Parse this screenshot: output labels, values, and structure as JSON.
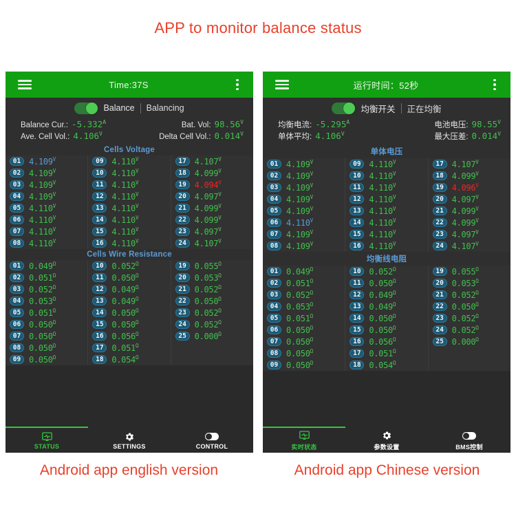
{
  "page": {
    "title": "APP to monitor balance status",
    "caption_left": "Android app english version",
    "caption_right": "Android app Chinese version",
    "accent_red": "#e8402a",
    "accent_green": "#12a013",
    "value_green": "#3fc14c",
    "badge_blue": "#1d5a75",
    "alert_red": "#f4231f",
    "section_blue": "#5b9bd5"
  },
  "en": {
    "appbar": {
      "menu_icon": "hamburger-icon",
      "title": "Time:37S",
      "overflow_icon": "kebab-menu-icon"
    },
    "toggle": {
      "label": "Balance",
      "state": "Balancing",
      "on": true
    },
    "info": [
      {
        "key": "Balance Cur.:",
        "value": "-5.332",
        "unit": "A"
      },
      {
        "key": "Bat. Vol:",
        "value": "98.56",
        "unit": "V"
      },
      {
        "key": "Ave. Cell Vol.:",
        "value": "4.106",
        "unit": "V"
      },
      {
        "key": "Delta Cell Vol.:",
        "value": "0.014",
        "unit": "V"
      }
    ],
    "voltage_section_title": "Cells Voltage",
    "voltage_unit": "V",
    "voltage_cells": [
      [
        {
          "id": "01",
          "v": "4.109",
          "s": "hi"
        },
        {
          "id": "02",
          "v": "4.109",
          "s": ""
        },
        {
          "id": "03",
          "v": "4.109",
          "s": ""
        },
        {
          "id": "04",
          "v": "4.109",
          "s": ""
        },
        {
          "id": "05",
          "v": "4.110",
          "s": ""
        },
        {
          "id": "06",
          "v": "4.110",
          "s": ""
        },
        {
          "id": "07",
          "v": "4.110",
          "s": ""
        },
        {
          "id": "08",
          "v": "4.110",
          "s": ""
        }
      ],
      [
        {
          "id": "09",
          "v": "4.110",
          "s": ""
        },
        {
          "id": "10",
          "v": "4.110",
          "s": ""
        },
        {
          "id": "11",
          "v": "4.110",
          "s": ""
        },
        {
          "id": "12",
          "v": "4.110",
          "s": ""
        },
        {
          "id": "13",
          "v": "4.110",
          "s": ""
        },
        {
          "id": "14",
          "v": "4.110",
          "s": ""
        },
        {
          "id": "15",
          "v": "4.110",
          "s": ""
        },
        {
          "id": "16",
          "v": "4.110",
          "s": ""
        }
      ],
      [
        {
          "id": "17",
          "v": "4.107",
          "s": ""
        },
        {
          "id": "18",
          "v": "4.099",
          "s": ""
        },
        {
          "id": "19",
          "v": "4.094",
          "s": "lo"
        },
        {
          "id": "20",
          "v": "4.097",
          "s": ""
        },
        {
          "id": "21",
          "v": "4.099",
          "s": ""
        },
        {
          "id": "22",
          "v": "4.099",
          "s": ""
        },
        {
          "id": "23",
          "v": "4.097",
          "s": ""
        },
        {
          "id": "24",
          "v": "4.107",
          "s": ""
        }
      ]
    ],
    "resistance_section_title": "Cells Wire Resistance",
    "resistance_unit": "Ω",
    "resistance_cells": [
      [
        {
          "id": "01",
          "v": "0.049",
          "s": ""
        },
        {
          "id": "02",
          "v": "0.051",
          "s": ""
        },
        {
          "id": "03",
          "v": "0.052",
          "s": ""
        },
        {
          "id": "04",
          "v": "0.053",
          "s": ""
        },
        {
          "id": "05",
          "v": "0.051",
          "s": ""
        },
        {
          "id": "06",
          "v": "0.050",
          "s": ""
        },
        {
          "id": "07",
          "v": "0.050",
          "s": ""
        },
        {
          "id": "08",
          "v": "0.050",
          "s": ""
        },
        {
          "id": "09",
          "v": "0.050",
          "s": ""
        }
      ],
      [
        {
          "id": "10",
          "v": "0.052",
          "s": ""
        },
        {
          "id": "11",
          "v": "0.050",
          "s": ""
        },
        {
          "id": "12",
          "v": "0.049",
          "s": ""
        },
        {
          "id": "13",
          "v": "0.049",
          "s": ""
        },
        {
          "id": "14",
          "v": "0.050",
          "s": ""
        },
        {
          "id": "15",
          "v": "0.050",
          "s": ""
        },
        {
          "id": "16",
          "v": "0.056",
          "s": ""
        },
        {
          "id": "17",
          "v": "0.051",
          "s": ""
        },
        {
          "id": "18",
          "v": "0.054",
          "s": ""
        }
      ],
      [
        {
          "id": "19",
          "v": "0.055",
          "s": ""
        },
        {
          "id": "20",
          "v": "0.053",
          "s": ""
        },
        {
          "id": "21",
          "v": "0.052",
          "s": ""
        },
        {
          "id": "22",
          "v": "0.050",
          "s": ""
        },
        {
          "id": "23",
          "v": "0.052",
          "s": ""
        },
        {
          "id": "24",
          "v": "0.052",
          "s": ""
        },
        {
          "id": "25",
          "v": "0.000",
          "s": ""
        }
      ]
    ],
    "nav": [
      {
        "label": "STATUS",
        "icon": "monitor-status-icon",
        "active": true
      },
      {
        "label": "SETTINGS",
        "icon": "gear-icon",
        "active": false
      },
      {
        "label": "CONTROL",
        "icon": "toggle-switch-icon",
        "active": false
      }
    ]
  },
  "zh": {
    "appbar": {
      "menu_icon": "hamburger-icon",
      "title": "运行时间：52秒",
      "overflow_icon": "kebab-menu-icon"
    },
    "toggle": {
      "label": "均衡开关",
      "state": "正在均衡",
      "on": true
    },
    "info": [
      {
        "key": "均衡电流:",
        "value": "-5.295",
        "unit": "A"
      },
      {
        "key": "电池电压:",
        "value": "98.55",
        "unit": "V"
      },
      {
        "key": "单体平均:",
        "value": "4.106",
        "unit": "V"
      },
      {
        "key": "最大压差:",
        "value": "0.014",
        "unit": "V"
      }
    ],
    "voltage_section_title": "单体电压",
    "voltage_unit": "V",
    "voltage_cells": [
      [
        {
          "id": "01",
          "v": "4.109",
          "s": ""
        },
        {
          "id": "02",
          "v": "4.109",
          "s": ""
        },
        {
          "id": "03",
          "v": "4.109",
          "s": ""
        },
        {
          "id": "04",
          "v": "4.109",
          "s": ""
        },
        {
          "id": "05",
          "v": "4.109",
          "s": ""
        },
        {
          "id": "06",
          "v": "4.110",
          "s": "hi"
        },
        {
          "id": "07",
          "v": "4.109",
          "s": ""
        },
        {
          "id": "08",
          "v": "4.109",
          "s": ""
        }
      ],
      [
        {
          "id": "09",
          "v": "4.110",
          "s": ""
        },
        {
          "id": "10",
          "v": "4.110",
          "s": ""
        },
        {
          "id": "11",
          "v": "4.110",
          "s": ""
        },
        {
          "id": "12",
          "v": "4.110",
          "s": ""
        },
        {
          "id": "13",
          "v": "4.110",
          "s": ""
        },
        {
          "id": "14",
          "v": "4.110",
          "s": ""
        },
        {
          "id": "15",
          "v": "4.110",
          "s": ""
        },
        {
          "id": "16",
          "v": "4.110",
          "s": ""
        }
      ],
      [
        {
          "id": "17",
          "v": "4.107",
          "s": ""
        },
        {
          "id": "18",
          "v": "4.099",
          "s": ""
        },
        {
          "id": "19",
          "v": "4.096",
          "s": "lo"
        },
        {
          "id": "20",
          "v": "4.097",
          "s": ""
        },
        {
          "id": "21",
          "v": "4.099",
          "s": ""
        },
        {
          "id": "22",
          "v": "4.099",
          "s": ""
        },
        {
          "id": "23",
          "v": "4.097",
          "s": ""
        },
        {
          "id": "24",
          "v": "4.107",
          "s": ""
        }
      ]
    ],
    "resistance_section_title": "均衡线电阻",
    "resistance_unit": "Ω",
    "resistance_cells": [
      [
        {
          "id": "01",
          "v": "0.049",
          "s": ""
        },
        {
          "id": "02",
          "v": "0.051",
          "s": ""
        },
        {
          "id": "03",
          "v": "0.052",
          "s": ""
        },
        {
          "id": "04",
          "v": "0.053",
          "s": ""
        },
        {
          "id": "05",
          "v": "0.051",
          "s": ""
        },
        {
          "id": "06",
          "v": "0.050",
          "s": ""
        },
        {
          "id": "07",
          "v": "0.050",
          "s": ""
        },
        {
          "id": "08",
          "v": "0.050",
          "s": ""
        },
        {
          "id": "09",
          "v": "0.050",
          "s": ""
        }
      ],
      [
        {
          "id": "10",
          "v": "0.052",
          "s": ""
        },
        {
          "id": "11",
          "v": "0.050",
          "s": ""
        },
        {
          "id": "12",
          "v": "0.049",
          "s": ""
        },
        {
          "id": "13",
          "v": "0.049",
          "s": ""
        },
        {
          "id": "14",
          "v": "0.050",
          "s": ""
        },
        {
          "id": "15",
          "v": "0.050",
          "s": ""
        },
        {
          "id": "16",
          "v": "0.056",
          "s": ""
        },
        {
          "id": "17",
          "v": "0.051",
          "s": ""
        },
        {
          "id": "18",
          "v": "0.054",
          "s": ""
        }
      ],
      [
        {
          "id": "19",
          "v": "0.055",
          "s": ""
        },
        {
          "id": "20",
          "v": "0.053",
          "s": ""
        },
        {
          "id": "21",
          "v": "0.052",
          "s": ""
        },
        {
          "id": "22",
          "v": "0.050",
          "s": ""
        },
        {
          "id": "23",
          "v": "0.052",
          "s": ""
        },
        {
          "id": "24",
          "v": "0.052",
          "s": ""
        },
        {
          "id": "25",
          "v": "0.000",
          "s": ""
        }
      ]
    ],
    "nav": [
      {
        "label": "实时状态",
        "icon": "monitor-status-icon",
        "active": true
      },
      {
        "label": "参数设置",
        "icon": "gear-icon",
        "active": false
      },
      {
        "label": "BMS控制",
        "icon": "toggle-switch-icon",
        "active": false
      }
    ]
  }
}
